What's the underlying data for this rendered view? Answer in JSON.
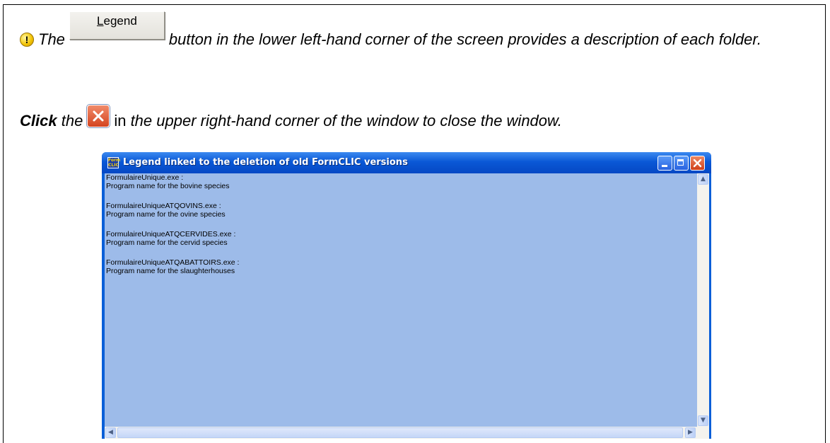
{
  "instructions": {
    "para1_the": "The",
    "legend_button_label_u": "L",
    "legend_button_label_rest": "egend",
    "para1_rest": "button in the lower left-hand corner of the screen provides a description of each folder.",
    "para2_click": "Click",
    "para2_the": "the",
    "para2_in": "in",
    "para2_rest": "the upper right-hand corner of the window to close the window."
  },
  "window": {
    "title": "Legend linked to the deletion of old FormCLIC versions",
    "icon_text": "Form CLIC",
    "entries": [
      {
        "file": "FormulaireUnique.exe :",
        "desc": "Program name for the bovine species"
      },
      {
        "file": "FormulaireUniqueATQOVINS.exe :",
        "desc": "Program name for the ovine species"
      },
      {
        "file": "FormulaireUniqueATQCERVIDES.exe :",
        "desc": "Program name for the cervid species"
      },
      {
        "file": "FormulaireUniqueATQABATTOIRS.exe :",
        "desc": "Program name for the slaughterhouses"
      }
    ]
  },
  "colors": {
    "client_bg": "#9dbbe9",
    "titlebar": "#0a58d6"
  }
}
